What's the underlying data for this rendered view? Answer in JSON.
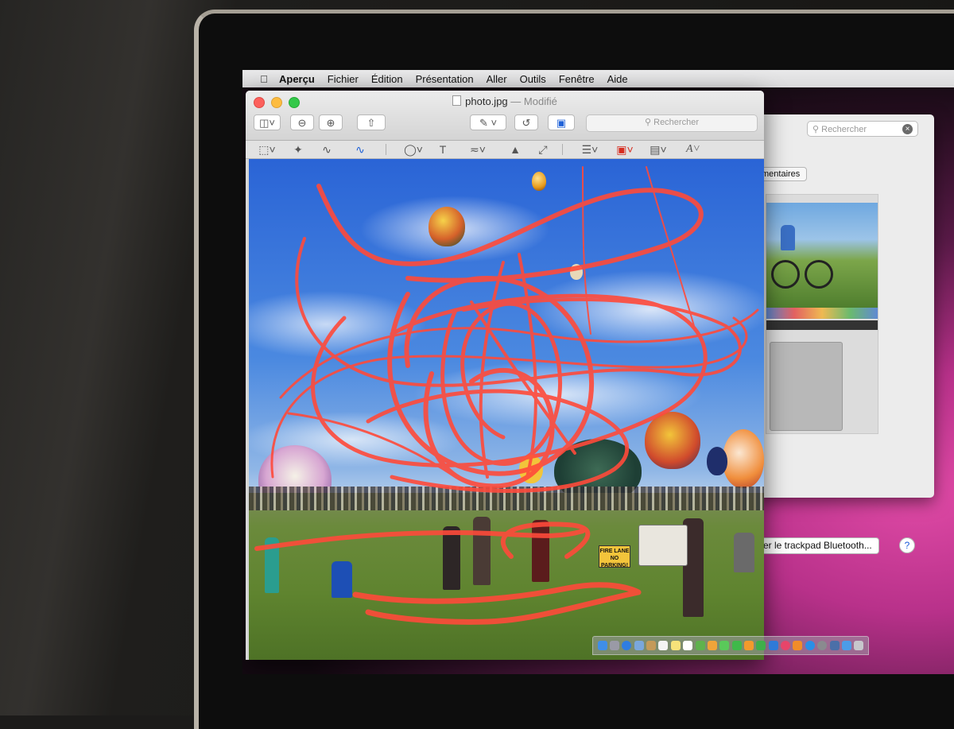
{
  "menubar": {
    "items": [
      "Aperçu",
      "Fichier",
      "Édition",
      "Présentation",
      "Aller",
      "Outils",
      "Fenêtre",
      "Aide"
    ]
  },
  "preview_window": {
    "filename": "photo.jpg",
    "separator": "—",
    "status": "Modifié",
    "search_placeholder": "Rechercher",
    "text_tool_label": "T",
    "font_tool_label": "A"
  },
  "prefs_window": {
    "search_placeholder": "Rechercher",
    "tab_label": "mentaires",
    "bluetooth_button": "rer le trackpad Bluetooth...",
    "help_label": "?"
  },
  "photo": {
    "sign_text": "FIRE LANE NO PARKING!",
    "scribble_color": "#ff4a3a",
    "description": "hot air balloon fiesta"
  },
  "colors": {
    "accent_blue": "#1f62d8",
    "close": "#fc605c",
    "minimize": "#fdbc40",
    "maximize": "#34c84a"
  },
  "dock": {
    "icons": [
      "finder-icon",
      "launchpad-icon",
      "safari-icon",
      "mail-icon",
      "contacts-icon",
      "calendar-icon",
      "notes-icon",
      "reminders-icon",
      "maps-icon",
      "photos-icon",
      "messages-icon",
      "facetime-icon",
      "pages-icon",
      "numbers-icon",
      "keynote-icon",
      "itunes-icon",
      "ibooks-icon",
      "appstore-icon",
      "preferences-icon",
      "preview-icon",
      "downloads-icon",
      "trash-icon"
    ]
  }
}
